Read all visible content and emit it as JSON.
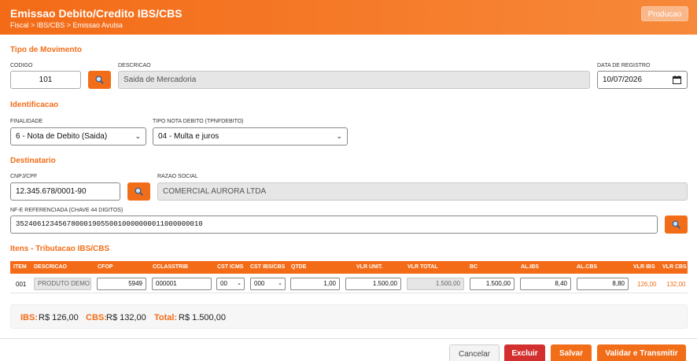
{
  "header": {
    "title": "Emissao Debito/Credito IBS/CBS",
    "breadcrumb": "Fiscal > IBS/CBS > Emissao Avulsa",
    "env_label": "Producao"
  },
  "movimento": {
    "section": "Tipo de Movimento",
    "codigo_label": "CODIGO",
    "codigo": "101",
    "descricao_label": "DESCRICAO",
    "descricao": "Saida de Mercadoria",
    "data_label": "DATA DE REGISTRO",
    "data": "10/07/2026"
  },
  "identificacao": {
    "section": "Identificacao",
    "finalidade_label": "FINALIDADE",
    "finalidade": "6 - Nota de Debito (Saida)",
    "tipo_label": "TIPO NOTA DEBITO (TPNFDEBITO)",
    "tipo": "04 - Multa e juros"
  },
  "destinatario": {
    "section": "Destinatario",
    "cnpj_label": "CNPJ/CPF",
    "cnpj": "12.345.678/0001-90",
    "razao_label": "RAZAO SOCIAL",
    "razao": "COMERCIAL AURORA LTDA",
    "nfe_label": "NF-E REFERENCIADA (CHAVE 44 DIGITOS)",
    "nfe": "35240612345678000190550010000000011000000010"
  },
  "itens": {
    "section": "Itens - Tributacao IBS/CBS",
    "columns": [
      "ITEM",
      "DESCRICAO",
      "CFOP",
      "CCLASSTRIB",
      "CST ICMS",
      "CST IBS/CBS",
      "QTDE",
      "VLR UNIT.",
      "VLR TOTAL",
      "BC",
      "AL.IBS",
      "AL.CBS",
      "VLR IBS",
      "VLR CBS"
    ],
    "rows": [
      {
        "item": "001",
        "descricao": "PRODUTO DEMO",
        "cfop": "5949",
        "cclasstrib": "000001",
        "cst_icms": "00",
        "cst_ibscbs": "000",
        "qtde": "1,00",
        "vlr_unit": "1.500,00",
        "vlr_total": "1.500,00",
        "bc": "1.500,00",
        "al_ibs": "8,40",
        "al_cbs": "8,80",
        "vlr_ibs": "126,00",
        "vlr_cbs": "132,00"
      }
    ]
  },
  "totals": {
    "ibs_label": "IBS:",
    "ibs": "R$ 126,00",
    "cbs_label": "CBS:",
    "cbs": "R$ 132,00",
    "total_label": "Total:",
    "total": "R$ 1.500,00"
  },
  "actions": {
    "cancel": "Cancelar",
    "delete": "Excluir",
    "save": "Salvar",
    "validate": "Validar e Transmitir"
  },
  "colors": {
    "accent": "#f26d18",
    "danger": "#d32f2f"
  }
}
